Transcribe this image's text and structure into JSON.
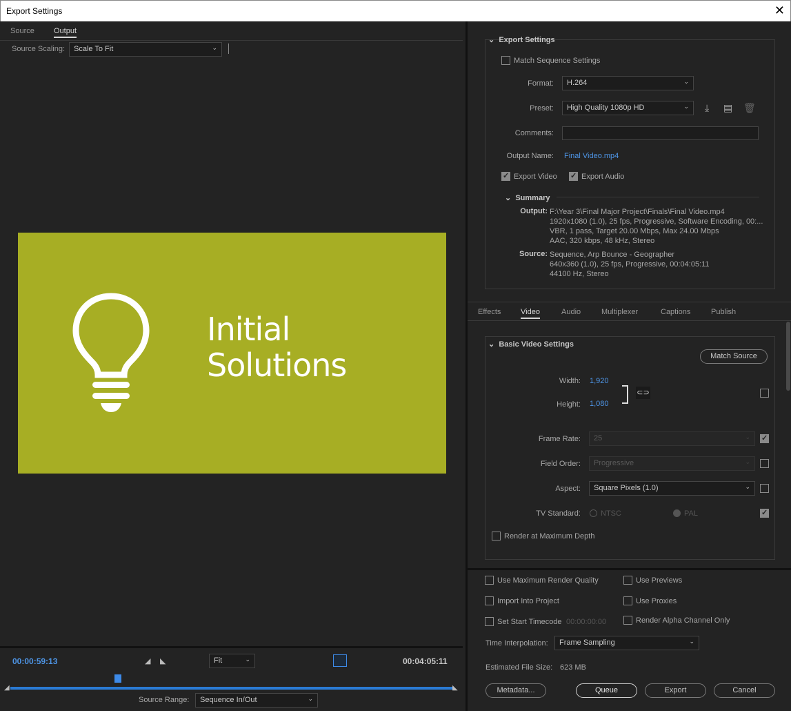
{
  "window": {
    "title": "Export Settings",
    "close": "✕"
  },
  "left": {
    "tabs": [
      {
        "label": "Source"
      },
      {
        "label": "Output"
      }
    ],
    "source_scaling": {
      "label": "Source Scaling:",
      "value": "Scale To Fit"
    },
    "preview": {
      "brand_line1": "Initial",
      "brand_line2": "Solutions",
      "bg": "#a7ae24"
    },
    "timeline": {
      "current_tc": "00:00:59:13",
      "duration_tc": "00:04:05:11",
      "zoom": "Fit",
      "source_range_label": "Source Range:",
      "source_range_value": "Sequence In/Out"
    }
  },
  "export_settings": {
    "header": "Export Settings",
    "match_sequence": "Match Sequence Settings",
    "format_label": "Format:",
    "format_value": "H.264",
    "preset_label": "Preset:",
    "preset_value": "High Quality 1080p HD",
    "comments_label": "Comments:",
    "output_name_label": "Output Name:",
    "output_name_value": "Final Video.mp4",
    "export_video": "Export Video",
    "export_audio": "Export Audio",
    "summary_header": "Summary",
    "summary_output_label": "Output:",
    "summary_output": [
      "F:\\Year 3\\Final Major Project\\Finals\\Final Video.mp4",
      "1920x1080 (1.0), 25 fps, Progressive, Software Encoding, 00:...",
      "VBR, 1 pass, Target 20.00 Mbps, Max 24.00 Mbps",
      "AAC, 320 kbps, 48 kHz, Stereo"
    ],
    "summary_source_label": "Source:",
    "summary_source": [
      "Sequence, Arp Bounce - Geographer",
      "640x360 (1.0), 25 fps, Progressive, 00:04:05:11",
      "44100 Hz, Stereo"
    ]
  },
  "settings_tabs": [
    {
      "label": "Effects"
    },
    {
      "label": "Video"
    },
    {
      "label": "Audio"
    },
    {
      "label": "Multiplexer"
    },
    {
      "label": "Captions"
    },
    {
      "label": "Publish"
    }
  ],
  "video": {
    "header": "Basic Video Settings",
    "match_source": "Match Source",
    "width_label": "Width:",
    "width_value": "1,920",
    "height_label": "Height:",
    "height_value": "1,080",
    "frame_rate_label": "Frame Rate:",
    "frame_rate_value": "25",
    "field_order_label": "Field Order:",
    "field_order_value": "Progressive",
    "aspect_label": "Aspect:",
    "aspect_value": "Square Pixels (1.0)",
    "tv_standard_label": "TV Standard:",
    "ntsc": "NTSC",
    "pal": "PAL",
    "render_max_depth": "Render at Maximum Depth"
  },
  "bottom": {
    "use_max_render": "Use Maximum Render Quality",
    "use_previews": "Use Previews",
    "import_into_project": "Import Into Project",
    "use_proxies": "Use Proxies",
    "set_start_tc": "Set Start Timecode",
    "start_tc_value": "00:00:00:00",
    "render_alpha": "Render Alpha Channel Only",
    "time_interp_label": "Time Interpolation:",
    "time_interp_value": "Frame Sampling",
    "est_size_label": "Estimated File Size:",
    "est_size_value": "623 MB",
    "metadata": "Metadata...",
    "queue": "Queue",
    "export": "Export",
    "cancel": "Cancel"
  }
}
